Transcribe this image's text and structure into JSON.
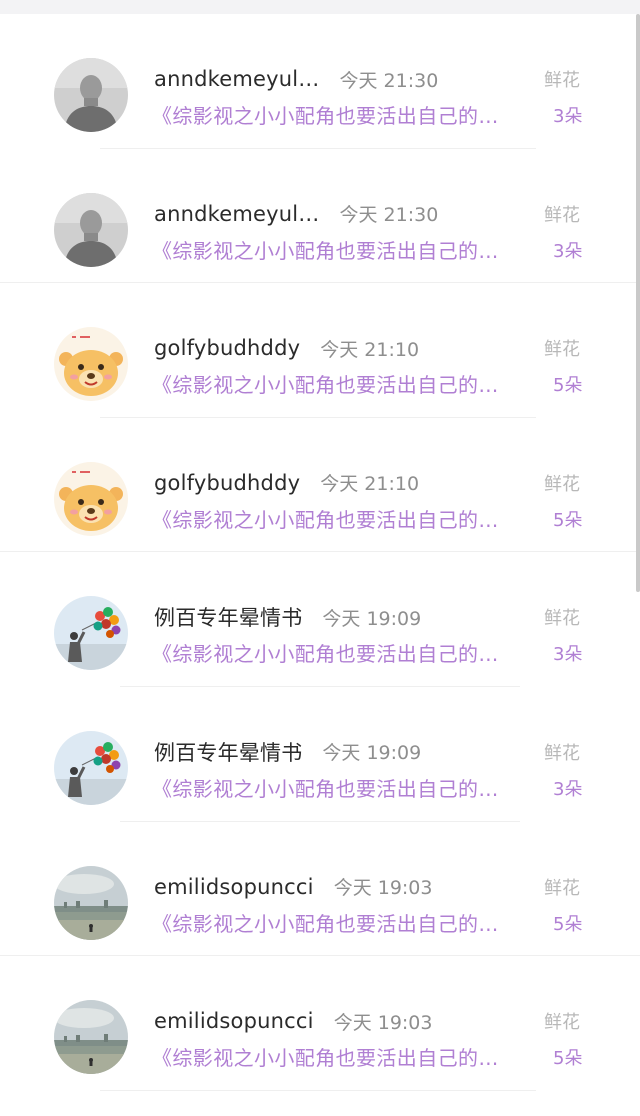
{
  "gift_records": [
    {
      "name": "anndkemeyul…",
      "time": "今天 21:30",
      "title": "《综影视之小小配角也要活出自己的…",
      "gift_type": "鲜花",
      "gift_count": "3朵",
      "avatar": "person-portrait-gray"
    },
    {
      "name": "anndkemeyul…",
      "time": "今天 21:30",
      "title": "《综影视之小小配角也要活出自己的…",
      "gift_type": "鲜花",
      "gift_count": "3朵",
      "avatar": "person-portrait-gray"
    },
    {
      "name": "golfybudhddy",
      "time": "今天 21:10",
      "title": "《综影视之小小配角也要活出自己的…",
      "gift_type": "鲜花",
      "gift_count": "5朵",
      "avatar": "cartoon-bear"
    },
    {
      "name": "golfybudhddy",
      "time": "今天 21:10",
      "title": "《综影视之小小配角也要活出自己的…",
      "gift_type": "鲜花",
      "gift_count": "5朵",
      "avatar": "cartoon-bear"
    },
    {
      "name": "例百专年晕情书",
      "time": "今天 19:09",
      "title": "《综影视之小小配角也要活出自己的…",
      "gift_type": "鲜花",
      "gift_count": "3朵",
      "avatar": "person-with-balloons"
    },
    {
      "name": "例百专年晕情书",
      "time": "今天 19:09",
      "title": "《综影视之小小配角也要活出自己的…",
      "gift_type": "鲜花",
      "gift_count": "3朵",
      "avatar": "person-with-balloons"
    },
    {
      "name": "emilidsopuncci",
      "time": "今天 19:03",
      "title": "《综影视之小小配角也要活出自己的…",
      "gift_type": "鲜花",
      "gift_count": "5朵",
      "avatar": "seaside-skyline"
    },
    {
      "name": "emilidsopuncci",
      "time": "今天 19:03",
      "title": "《综影视之小小配角也要活出自己的…",
      "gift_type": "鲜花",
      "gift_count": "5朵",
      "avatar": "seaside-skyline"
    }
  ],
  "colors": {
    "accent_purple": "#b07fd3",
    "name_text": "#2b2b2b",
    "meta_gray": "#8e8e8e",
    "gift_type_gray": "#b8b8b8",
    "divider": "#efefef"
  }
}
